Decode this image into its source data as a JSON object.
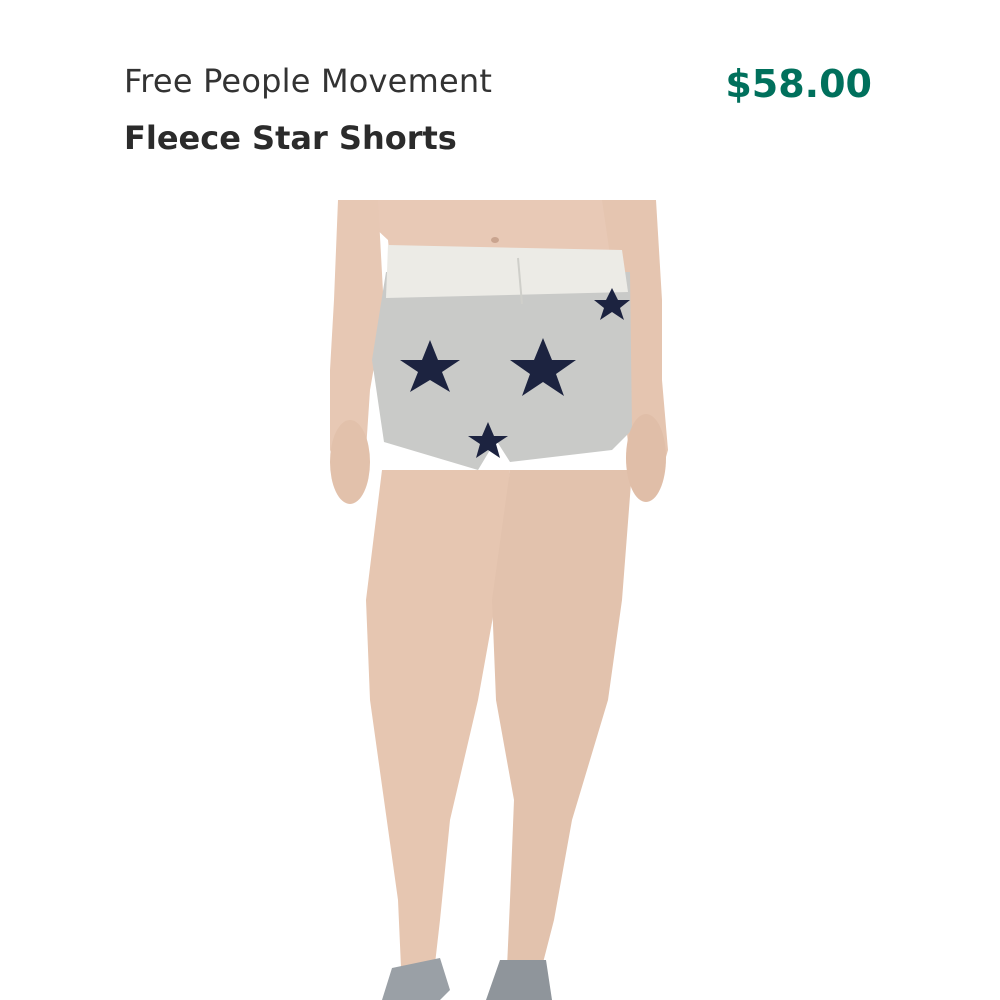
{
  "product": {
    "brand": "Free People Movement",
    "name": "Fleece Star Shorts",
    "price": "$58.00"
  },
  "colors": {
    "price": "#00705c",
    "text": "#2b2b2b",
    "shorts": "#c9cac8",
    "waistband": "#ecebe6",
    "stars": "#1c2340",
    "skin": "#e7c8b4",
    "shoes": "#9aa0a6"
  }
}
